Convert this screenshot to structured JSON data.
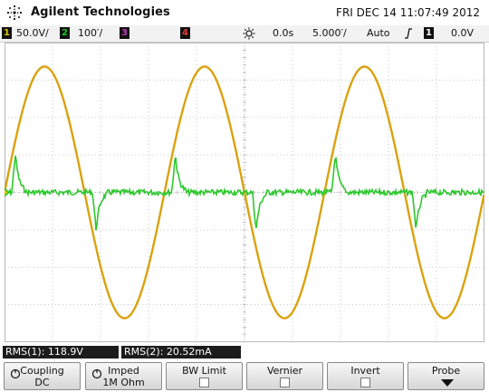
{
  "header": {
    "brand": "Agilent Technologies",
    "datetime": "FRI DEC 14 11:07:49 2012",
    "logo_icon": "agilent-spark-logo"
  },
  "statusbar": {
    "ch1": {
      "number": "1",
      "scale": "50.0V/",
      "color": "#e3c100"
    },
    "ch2": {
      "number": "2",
      "scale": "100′/",
      "color": "#14c81e"
    },
    "ch3": {
      "number": "3",
      "color": "#c238c2"
    },
    "ch4": {
      "number": "4",
      "color": "#e23b3b"
    },
    "timebase_icon": "sun-trigger-icon",
    "time_position": "0.0s",
    "time_scale": "5.000′/",
    "trigger_mode": "Auto",
    "slope_icon": "rising-edge-icon",
    "trigger_channel": "1",
    "trigger_level": "0.0V"
  },
  "measurements": {
    "m1": {
      "prefix": "RMS(",
      "channel": "1",
      "suffix": "): 118.9V"
    },
    "m2": {
      "prefix": "RMS(",
      "channel": "2",
      "suffix": "): 20.52mA"
    }
  },
  "softkeys": [
    {
      "line1": "Coupling",
      "line2": "DC"
    },
    {
      "line1": "Imped",
      "line2": "1M Ohm"
    },
    {
      "line1": "BW Limit"
    },
    {
      "line1": "Vernier"
    },
    {
      "line1": "Invert"
    },
    {
      "line1": "Probe"
    }
  ],
  "colors": {
    "ch1_trace": "#d9a20f",
    "ch2_trace": "#2ec82e",
    "grid": "#b7b7b7",
    "ground_marker_ch1": "#e3c100",
    "ground_marker_ch2": "#14c81e"
  },
  "chart_data": {
    "type": "line",
    "divisions": {
      "x": 10,
      "y": 8
    },
    "series": [
      {
        "name": "",
        "channel": 1,
        "waveform": "sine",
        "volts_per_div": 50.0,
        "rms_v": 118.9,
        "peak_v": 168,
        "cycles_visible": 3,
        "phase_start_cycles": 0.0
      },
      {
        "name": "",
        "channel": 2,
        "waveform": "spikes",
        "rms_ma": 20.52,
        "spike_positions_cycles": [
          0.045,
          0.55,
          1.045,
          1.55,
          2.045,
          2.55
        ]
      }
    ]
  }
}
